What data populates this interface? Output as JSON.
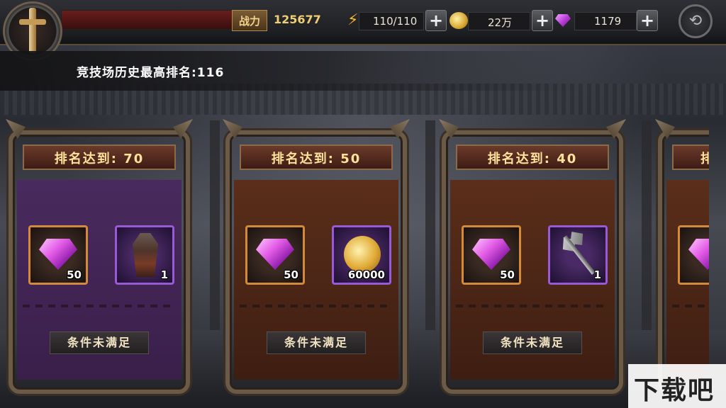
{
  "topbar": {
    "power_label": "战力",
    "power_value": "125677",
    "stamina": "110/110",
    "gold": "22万",
    "gems": "1179",
    "plus": "+",
    "back_icon": "⟲"
  },
  "history": {
    "text": "竞技场历史最高排名:116"
  },
  "cards": [
    {
      "title": "排名达到: 70",
      "theme": "purple",
      "items": [
        {
          "icon": "gem-icon",
          "qty": "50",
          "frame": "orange"
        },
        {
          "icon": "armor-icon",
          "qty": "1",
          "frame": "purple"
        }
      ],
      "status": "条件未满足"
    },
    {
      "title": "排名达到: 50",
      "theme": "brown",
      "items": [
        {
          "icon": "gem-icon",
          "qty": "50",
          "frame": "orange"
        },
        {
          "icon": "gold-coin-icon",
          "qty": "60000",
          "frame": "purple"
        }
      ],
      "status": "条件未满足"
    },
    {
      "title": "排名达到: 40",
      "theme": "brown",
      "items": [
        {
          "icon": "gem-icon",
          "qty": "50",
          "frame": "orange"
        },
        {
          "icon": "axe-icon",
          "qty": "1",
          "frame": "purple"
        }
      ],
      "status": "条件未满足"
    },
    {
      "title": "排",
      "theme": "brown",
      "items": [
        {
          "icon": "gem-icon",
          "qty": "",
          "frame": "orange"
        }
      ],
      "status": ""
    }
  ],
  "watermark": "下载吧",
  "colors": {
    "purple_card": "#4a2a5e",
    "brown_card": "#4e2a18",
    "title_text": "#ffe19a",
    "accent_gold": "#f0cf73"
  }
}
